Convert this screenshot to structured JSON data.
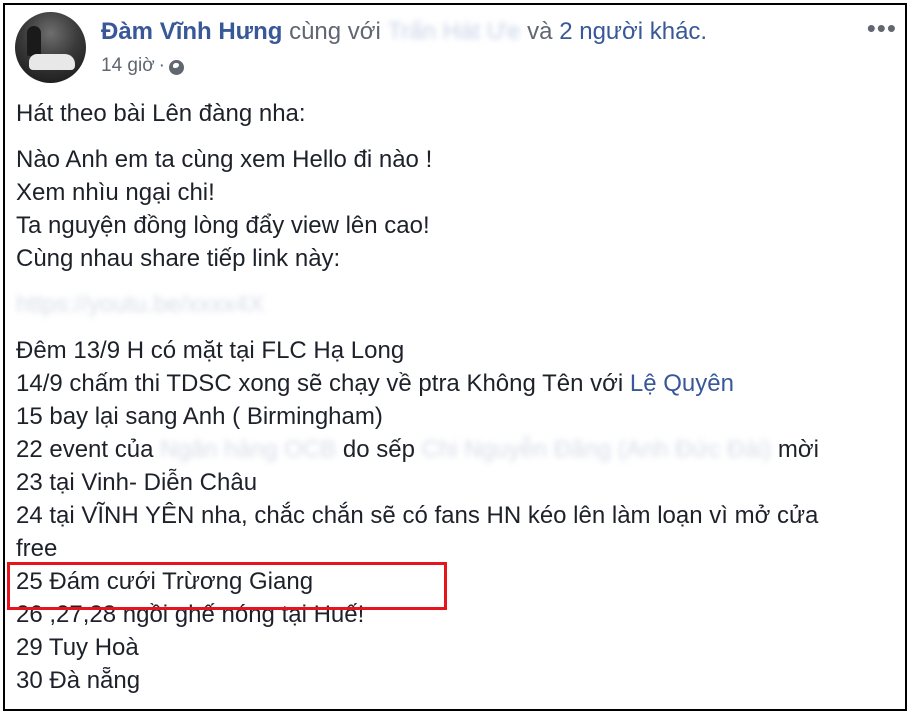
{
  "post": {
    "author": "Đàm Vĩnh Hưng",
    "with_text": "cùng với",
    "tagged_blurred": "Trấn Hát Ưe",
    "and_text": "và",
    "others": "2 người khác.",
    "time": "14 giờ",
    "sep": "·",
    "more_icon": "•••"
  },
  "content": {
    "intro": "Hát theo bài Lên đàng nha:",
    "lyrics": [
      "Nào Anh em ta cùng xem Hello đi nào !",
      "Xem nhìu ngại chi!",
      "Ta nguyện đồng lòng đẩy view lên cao!",
      "Cùng nhau share tiếp link này:"
    ],
    "blurred_link": "https://youtu.be/xxxx4X",
    "schedule": {
      "l1": "Đêm 13/9 H có mặt tại FLC Hạ Long",
      "l2_pre": "14/9 chấm thi TDSC xong sẽ chạy về ptra Không Tên với ",
      "l2_link": "Lệ Quyên",
      "l3": "15 bay lại sang Anh ( Birmingham)",
      "l4_pre": "22 event của ",
      "l4_blur1": "Ngân hàng OCB",
      "l4_mid": " do sếp ",
      "l4_blur2": "Chi Nguyễn Đăng (Anh Đức Đài)",
      "l4_post": " mời",
      "l5": "23 tại Vinh- Diễn Châu",
      "l6a": "24 tại VĨNH YÊN nha, chắc chắn sẽ có fans HN kéo lên làm loạn vì mở cửa",
      "l6b": "free",
      "l7": "25 Đám cưới Trừơng Giang",
      "l8": "26 ,27,28 ngồi ghế nóng tại Huế!",
      "l9": "29 Tuy Hoà",
      "l10": "30 Đà nẵng"
    }
  },
  "colors": {
    "link": "#385898",
    "highlight_border": "#e8141d"
  }
}
